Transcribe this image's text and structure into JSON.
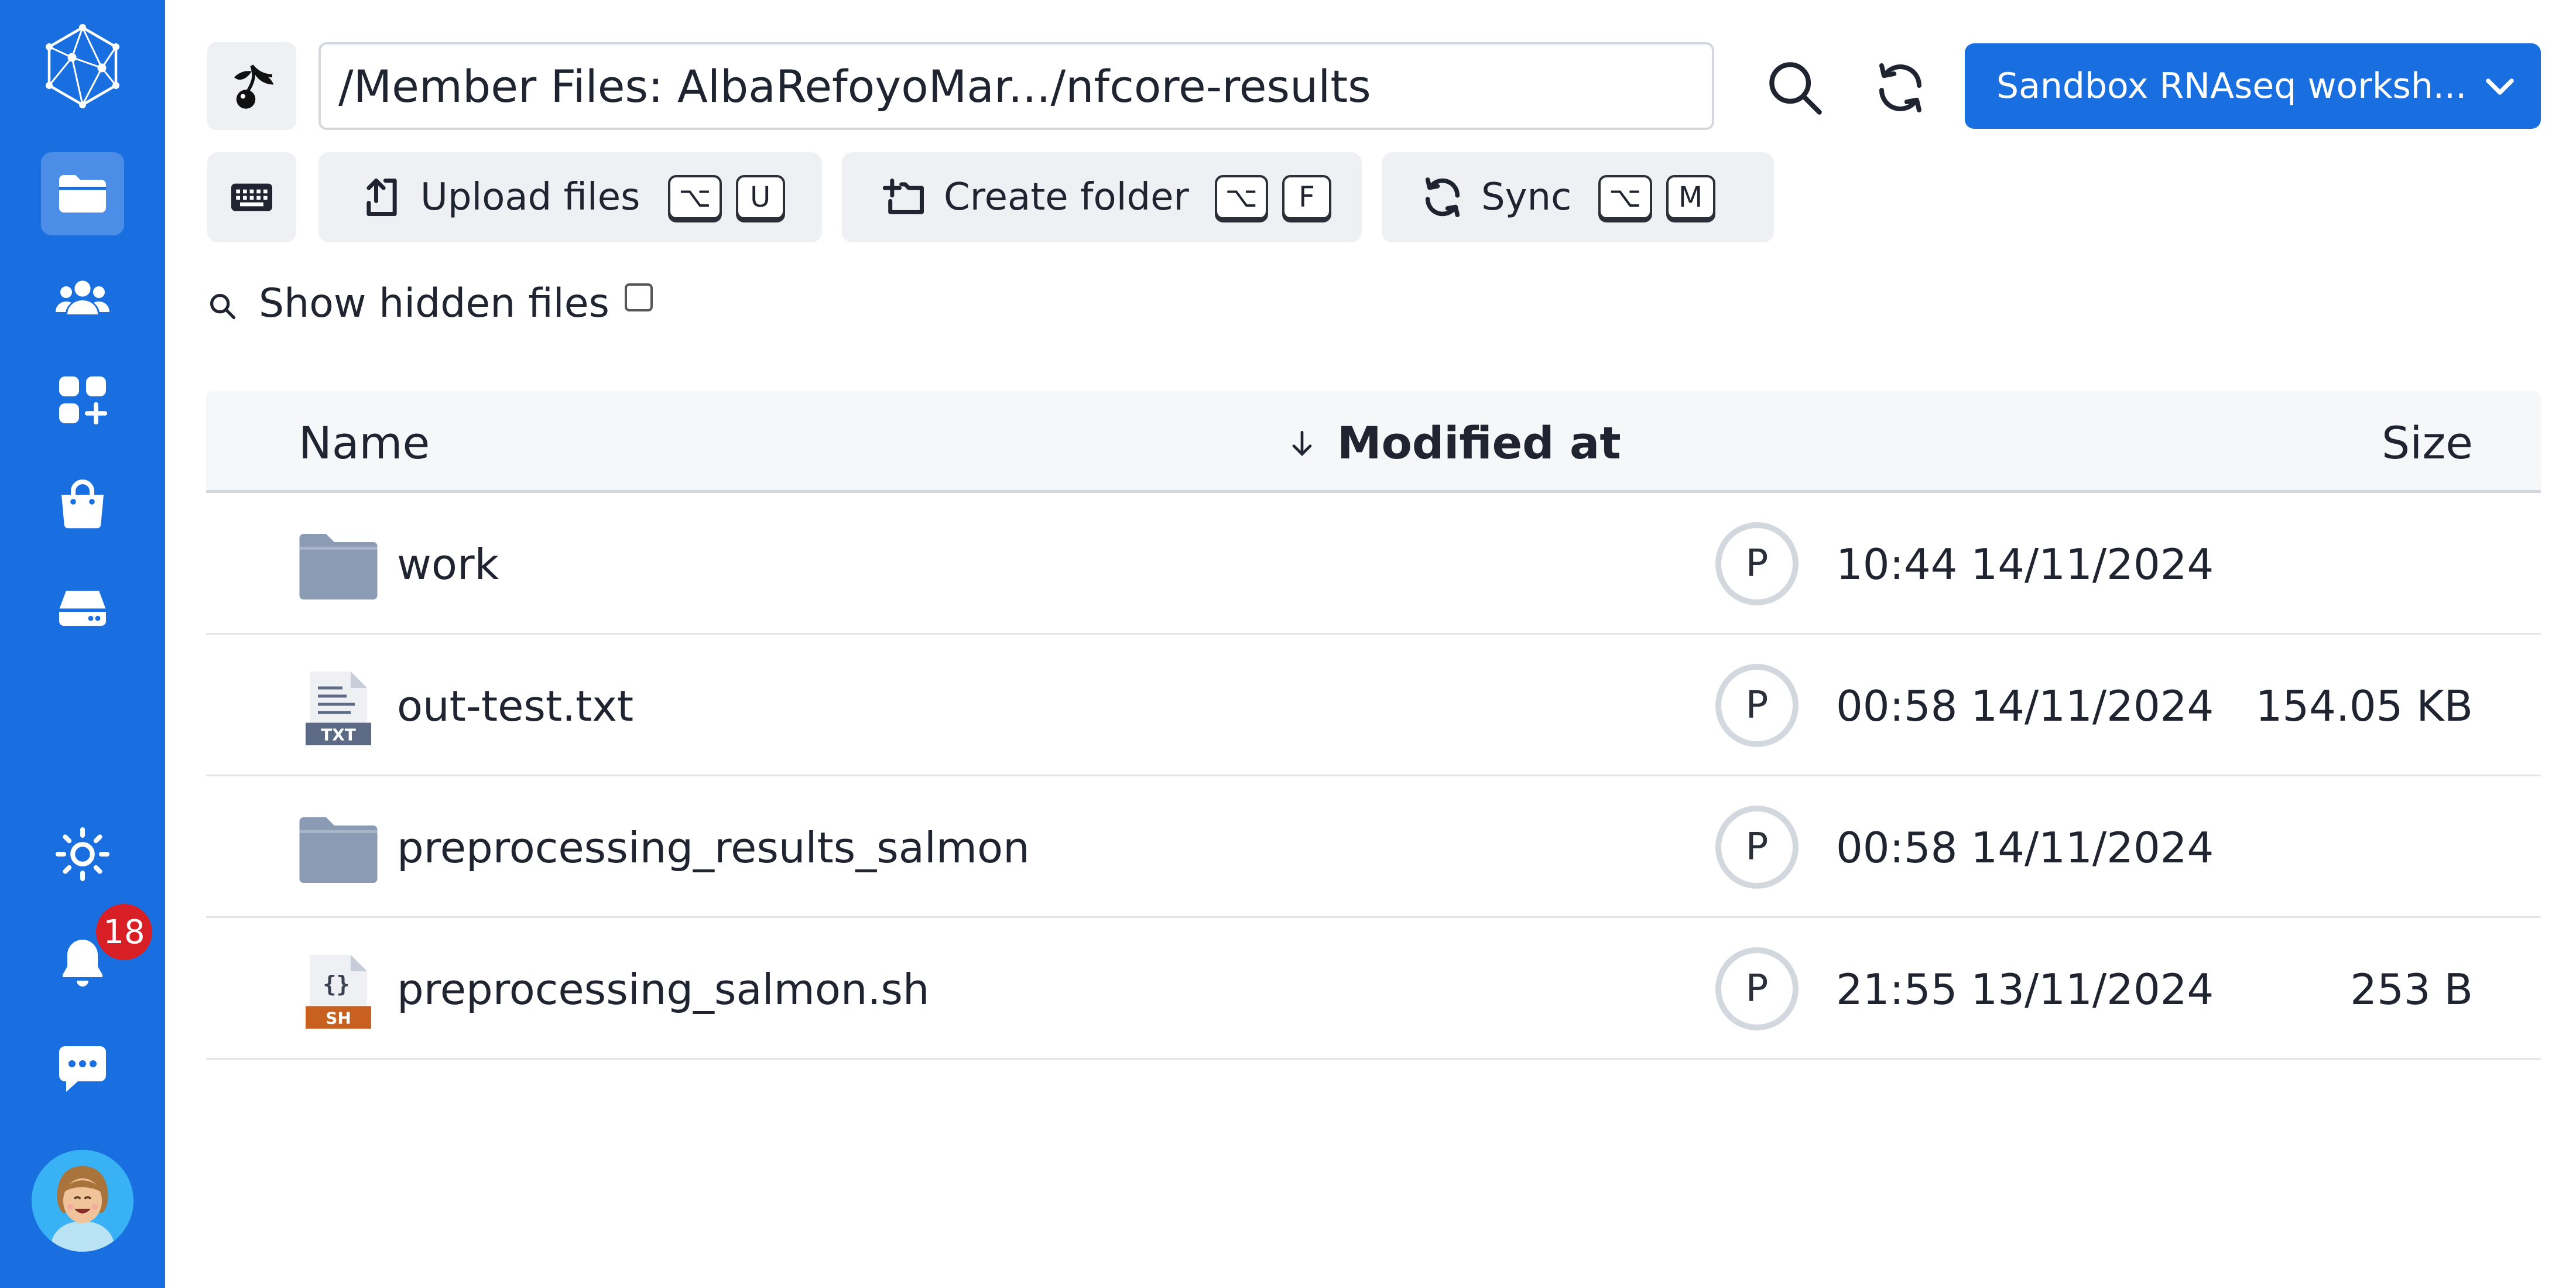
{
  "sidebar": {
    "items": [
      "files-icon",
      "members-icon",
      "apps-icon",
      "shop-icon",
      "drives-icon"
    ],
    "notifications_count": "18"
  },
  "toolbar": {
    "path": "/Member Files: AlbaRefoyoMar.../nfcore-results",
    "project": "Sandbox RNAseq worksh..."
  },
  "actions": {
    "upload": {
      "label": "Upload files",
      "key1": "⌥",
      "key2": "U"
    },
    "folder": {
      "label": "Create folder",
      "key1": "⌥",
      "key2": "F"
    },
    "sync": {
      "label": "Sync",
      "key1": "⌥",
      "key2": "M"
    }
  },
  "hidden_files_label": "Show hidden files",
  "table": {
    "columns": {
      "name": "Name",
      "modified": "Modified at",
      "size": "Size"
    },
    "rows": [
      {
        "name": "work",
        "icon": "folder-icon",
        "owner": "P",
        "modified": "10:44 14/11/2024",
        "size": ""
      },
      {
        "name": "out-test.txt",
        "icon": "txt-file-icon",
        "owner": "P",
        "modified": "00:58 14/11/2024",
        "size": "154.05 KB"
      },
      {
        "name": "preprocessing_results_salmon",
        "icon": "folder-icon",
        "owner": "P",
        "modified": "00:58 14/11/2024",
        "size": ""
      },
      {
        "name": "preprocessing_salmon.sh",
        "icon": "sh-file-icon",
        "owner": "P",
        "modified": "21:55 13/11/2024",
        "size": "253 B"
      }
    ]
  },
  "colors": {
    "accent": "#1a6fe0",
    "badge": "#d81f26",
    "folder": "#8a9bb3",
    "sh_label": "#c8601f",
    "txt_label": "#5d6a86"
  }
}
